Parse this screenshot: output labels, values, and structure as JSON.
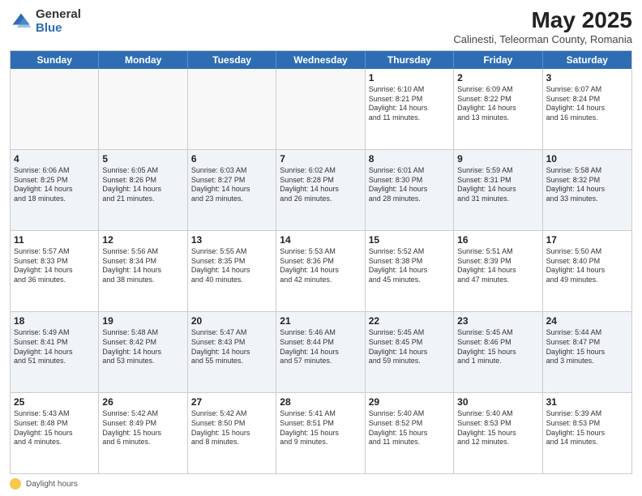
{
  "header": {
    "logo_general": "General",
    "logo_blue": "Blue",
    "month_title": "May 2025",
    "subtitle": "Calinesti, Teleorman County, Romania"
  },
  "day_headers": [
    "Sunday",
    "Monday",
    "Tuesday",
    "Wednesday",
    "Thursday",
    "Friday",
    "Saturday"
  ],
  "weeks": [
    {
      "alt": false,
      "days": [
        {
          "num": "",
          "info": ""
        },
        {
          "num": "",
          "info": ""
        },
        {
          "num": "",
          "info": ""
        },
        {
          "num": "",
          "info": ""
        },
        {
          "num": "1",
          "info": "Sunrise: 6:10 AM\nSunset: 8:21 PM\nDaylight: 14 hours\nand 11 minutes."
        },
        {
          "num": "2",
          "info": "Sunrise: 6:09 AM\nSunset: 8:22 PM\nDaylight: 14 hours\nand 13 minutes."
        },
        {
          "num": "3",
          "info": "Sunrise: 6:07 AM\nSunset: 8:24 PM\nDaylight: 14 hours\nand 16 minutes."
        }
      ]
    },
    {
      "alt": true,
      "days": [
        {
          "num": "4",
          "info": "Sunrise: 6:06 AM\nSunset: 8:25 PM\nDaylight: 14 hours\nand 18 minutes."
        },
        {
          "num": "5",
          "info": "Sunrise: 6:05 AM\nSunset: 8:26 PM\nDaylight: 14 hours\nand 21 minutes."
        },
        {
          "num": "6",
          "info": "Sunrise: 6:03 AM\nSunset: 8:27 PM\nDaylight: 14 hours\nand 23 minutes."
        },
        {
          "num": "7",
          "info": "Sunrise: 6:02 AM\nSunset: 8:28 PM\nDaylight: 14 hours\nand 26 minutes."
        },
        {
          "num": "8",
          "info": "Sunrise: 6:01 AM\nSunset: 8:30 PM\nDaylight: 14 hours\nand 28 minutes."
        },
        {
          "num": "9",
          "info": "Sunrise: 5:59 AM\nSunset: 8:31 PM\nDaylight: 14 hours\nand 31 minutes."
        },
        {
          "num": "10",
          "info": "Sunrise: 5:58 AM\nSunset: 8:32 PM\nDaylight: 14 hours\nand 33 minutes."
        }
      ]
    },
    {
      "alt": false,
      "days": [
        {
          "num": "11",
          "info": "Sunrise: 5:57 AM\nSunset: 8:33 PM\nDaylight: 14 hours\nand 36 minutes."
        },
        {
          "num": "12",
          "info": "Sunrise: 5:56 AM\nSunset: 8:34 PM\nDaylight: 14 hours\nand 38 minutes."
        },
        {
          "num": "13",
          "info": "Sunrise: 5:55 AM\nSunset: 8:35 PM\nDaylight: 14 hours\nand 40 minutes."
        },
        {
          "num": "14",
          "info": "Sunrise: 5:53 AM\nSunset: 8:36 PM\nDaylight: 14 hours\nand 42 minutes."
        },
        {
          "num": "15",
          "info": "Sunrise: 5:52 AM\nSunset: 8:38 PM\nDaylight: 14 hours\nand 45 minutes."
        },
        {
          "num": "16",
          "info": "Sunrise: 5:51 AM\nSunset: 8:39 PM\nDaylight: 14 hours\nand 47 minutes."
        },
        {
          "num": "17",
          "info": "Sunrise: 5:50 AM\nSunset: 8:40 PM\nDaylight: 14 hours\nand 49 minutes."
        }
      ]
    },
    {
      "alt": true,
      "days": [
        {
          "num": "18",
          "info": "Sunrise: 5:49 AM\nSunset: 8:41 PM\nDaylight: 14 hours\nand 51 minutes."
        },
        {
          "num": "19",
          "info": "Sunrise: 5:48 AM\nSunset: 8:42 PM\nDaylight: 14 hours\nand 53 minutes."
        },
        {
          "num": "20",
          "info": "Sunrise: 5:47 AM\nSunset: 8:43 PM\nDaylight: 14 hours\nand 55 minutes."
        },
        {
          "num": "21",
          "info": "Sunrise: 5:46 AM\nSunset: 8:44 PM\nDaylight: 14 hours\nand 57 minutes."
        },
        {
          "num": "22",
          "info": "Sunrise: 5:45 AM\nSunset: 8:45 PM\nDaylight: 14 hours\nand 59 minutes."
        },
        {
          "num": "23",
          "info": "Sunrise: 5:45 AM\nSunset: 8:46 PM\nDaylight: 15 hours\nand 1 minute."
        },
        {
          "num": "24",
          "info": "Sunrise: 5:44 AM\nSunset: 8:47 PM\nDaylight: 15 hours\nand 3 minutes."
        }
      ]
    },
    {
      "alt": false,
      "days": [
        {
          "num": "25",
          "info": "Sunrise: 5:43 AM\nSunset: 8:48 PM\nDaylight: 15 hours\nand 4 minutes."
        },
        {
          "num": "26",
          "info": "Sunrise: 5:42 AM\nSunset: 8:49 PM\nDaylight: 15 hours\nand 6 minutes."
        },
        {
          "num": "27",
          "info": "Sunrise: 5:42 AM\nSunset: 8:50 PM\nDaylight: 15 hours\nand 8 minutes."
        },
        {
          "num": "28",
          "info": "Sunrise: 5:41 AM\nSunset: 8:51 PM\nDaylight: 15 hours\nand 9 minutes."
        },
        {
          "num": "29",
          "info": "Sunrise: 5:40 AM\nSunset: 8:52 PM\nDaylight: 15 hours\nand 11 minutes."
        },
        {
          "num": "30",
          "info": "Sunrise: 5:40 AM\nSunset: 8:53 PM\nDaylight: 15 hours\nand 12 minutes."
        },
        {
          "num": "31",
          "info": "Sunrise: 5:39 AM\nSunset: 8:53 PM\nDaylight: 15 hours\nand 14 minutes."
        }
      ]
    }
  ],
  "legend": {
    "daylight_label": "Daylight hours"
  }
}
